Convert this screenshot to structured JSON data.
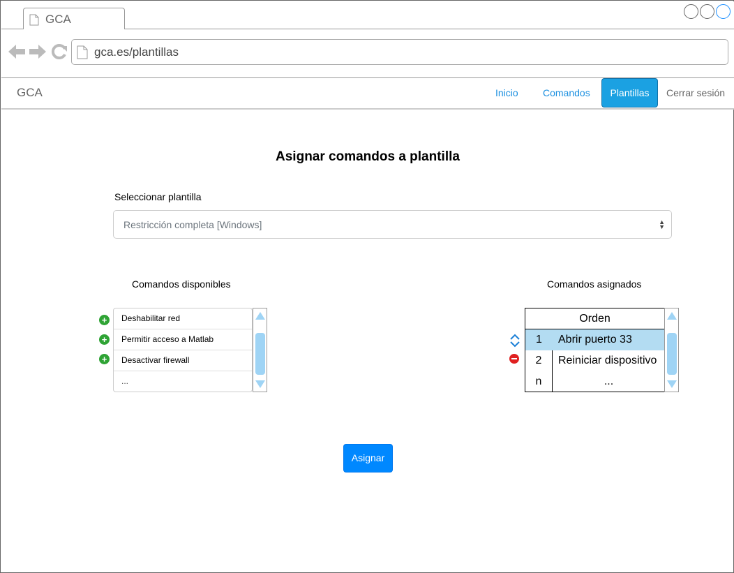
{
  "browser": {
    "tab_title": "GCA",
    "url": "gca.es/plantillas"
  },
  "navbar": {
    "brand": "GCA",
    "links": [
      {
        "label": "Inicio"
      },
      {
        "label": "Comandos"
      },
      {
        "label": "Plantillas",
        "active": true
      },
      {
        "label": "Cerrar sesión"
      }
    ]
  },
  "main": {
    "title": "Asignar comandos a plantilla",
    "select_label": "Seleccionar plantilla",
    "select_value": "Restricción completa [Windows]",
    "available": {
      "title": "Comandos disponibles",
      "items": [
        "Deshabilitar red",
        "Permitir acceso a Matlab",
        "Desactivar firewall",
        "..."
      ]
    },
    "assigned": {
      "title": "Comandos asignados",
      "header": "Orden",
      "rows": [
        {
          "num": "1",
          "cmd": "Abrir puerto 33",
          "selected": true
        },
        {
          "num": "2",
          "cmd": "Reiniciar dispositivo"
        },
        {
          "num": "n",
          "cmd": "..."
        }
      ]
    },
    "assign_button": "Asignar"
  },
  "colors": {
    "accent": "#1ba1e2",
    "button": "#0088ff",
    "link": "#1a8fe0",
    "selected_row": "#b3dcf2",
    "add_icon": "#2ea334",
    "remove_icon": "#e02020"
  }
}
